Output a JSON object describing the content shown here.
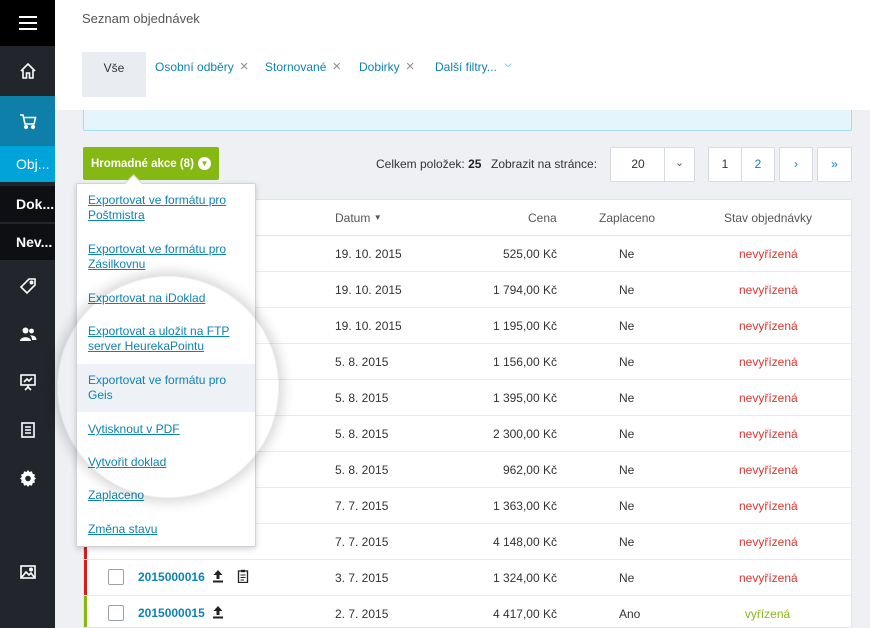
{
  "header": {
    "title": "Seznam objednávek",
    "tabs": [
      {
        "label": "Vše"
      },
      {
        "label": "Osobní odběry"
      },
      {
        "label": "Stornované"
      },
      {
        "label": "Dobirky"
      },
      {
        "label": "Další filtry..."
      }
    ]
  },
  "sidebar": {
    "items": [
      {
        "label": "Obj..."
      },
      {
        "label": "Dok..."
      },
      {
        "label": "Nev..."
      }
    ]
  },
  "toolbar": {
    "bulk_label": "Hromadné akce (8)",
    "total_label": "Celkem položek:",
    "total_value": "25",
    "perpage_label": "Zobrazit na stránce:",
    "perpage_value": "20",
    "pages": [
      "1",
      "2"
    ],
    "next": "›",
    "last": "»"
  },
  "table": {
    "headers": {
      "date": "Datum",
      "price": "Cena",
      "paid": "Zaplaceno",
      "state": "Stav objednávky"
    },
    "rows": [
      {
        "date": "19. 10. 2015",
        "price": "525,00 Kč",
        "paid": "Ne",
        "state": "nevyřízená"
      },
      {
        "date": "19. 10. 2015",
        "price": "1 794,00 Kč",
        "paid": "Ne",
        "state": "nevyřízená"
      },
      {
        "date": "19. 10. 2015",
        "price": "1 195,00 Kč",
        "paid": "Ne",
        "state": "nevyřízená"
      },
      {
        "date": "5. 8. 2015",
        "price": "1 156,00 Kč",
        "paid": "Ne",
        "state": "nevyřízená"
      },
      {
        "date": "5. 8. 2015",
        "price": "1 395,00 Kč",
        "paid": "Ne",
        "state": "nevyřízená"
      },
      {
        "date": "5. 8. 2015",
        "price": "2 300,00 Kč",
        "paid": "Ne",
        "state": "nevyřízená"
      },
      {
        "date": "5. 8. 2015",
        "price": "962,00 Kč",
        "paid": "Ne",
        "state": "nevyřízená"
      },
      {
        "date": "7. 7. 2015",
        "price": "1 363,00 Kč",
        "paid": "Ne",
        "state": "nevyřízená"
      },
      {
        "date": "7. 7. 2015",
        "price": "4 148,00 Kč",
        "paid": "Ne",
        "state": "nevyřízená"
      },
      {
        "order": "2015000016",
        "date": "3. 7. 2015",
        "price": "1 324,00 Kč",
        "paid": "Ne",
        "state": "nevyřízená"
      },
      {
        "order": "2015000015",
        "date": "2. 7. 2015",
        "price": "4 417,00 Kč",
        "paid": "Ano",
        "state": "vyřízená"
      }
    ]
  },
  "dropdown": {
    "items": [
      "Exportovat ve formátu pro Poštmistra",
      "Exportovat ve formátu pro Zásilkovnu",
      "Exportovat na iDoklad",
      "Exportovat a uložit na FTP server HeurekaPointu",
      "Exportovat ve formátu pro Geis",
      "Vytisknout v PDF",
      "Vytvořit doklad",
      "Zaplaceno",
      "Změna stavu"
    ]
  },
  "colors": {
    "accent": "#00a4d8",
    "primary_button": "#86b814",
    "link": "#0e83b3",
    "status_open": "#e1332c",
    "status_done": "#86b814"
  }
}
